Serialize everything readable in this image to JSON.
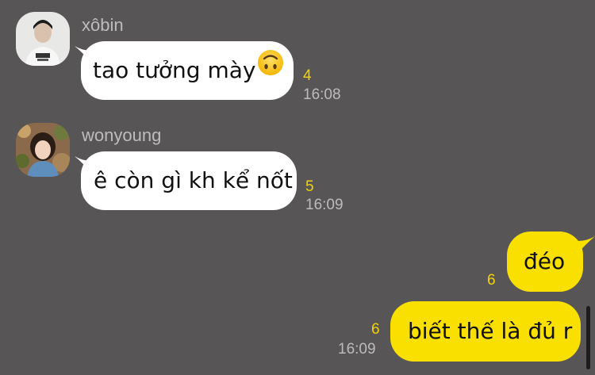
{
  "messages": [
    {
      "sender": "xôbin",
      "text": "tao tưởng mày",
      "emoji": "upside-down-face",
      "count": "4",
      "time": "16:08"
    },
    {
      "sender": "wonyoung",
      "text": "ê còn gì kh kể nốt",
      "count": "5",
      "time": "16:09"
    },
    {
      "text": "đéo",
      "count": "6"
    },
    {
      "text": "biết thế là đủ r",
      "count": "6",
      "time": "16:09"
    }
  ],
  "colors": {
    "background": "#575556",
    "incoming_bubble": "#ffffff",
    "outgoing_bubble": "#f9e000",
    "unread_count": "#f2d20a"
  }
}
